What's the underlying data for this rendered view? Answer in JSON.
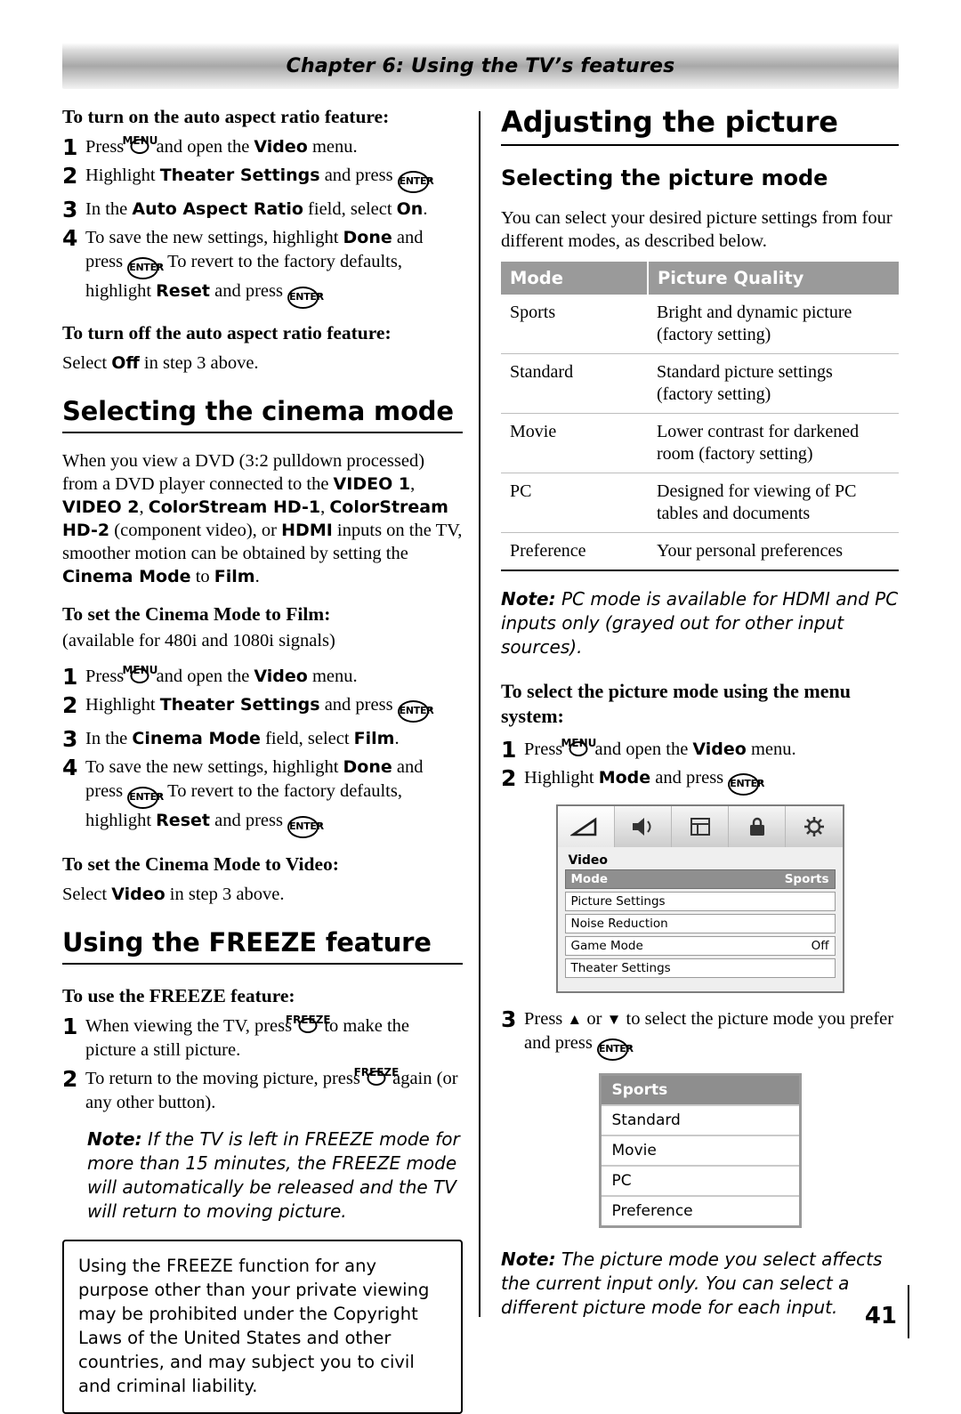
{
  "header": {
    "chapter": "Chapter 6: Using the TV’s features"
  },
  "page_number": "41",
  "left": {
    "auto_on_heading": "To turn on the auto aspect ratio feature:",
    "auto_on_steps": [
      {
        "num": "1",
        "parts": [
          "Press ",
          "MENU",
          " and open the ",
          "Video",
          " menu."
        ]
      },
      {
        "num": "2",
        "parts": [
          "Highlight ",
          "Theater Settings",
          " and press ",
          "ENTER",
          "."
        ]
      },
      {
        "num": "3",
        "parts": [
          "In the ",
          "Auto Aspect Ratio",
          " field, select ",
          "On",
          "."
        ]
      },
      {
        "num": "4",
        "parts": [
          "To save the new settings, highlight ",
          "Done",
          " and press ",
          "ENTER",
          ". To revert to the factory defaults, highlight ",
          "Reset",
          " and press ",
          "ENTER",
          "."
        ]
      }
    ],
    "auto_off_heading": "To turn off the auto aspect ratio feature:",
    "auto_off_text_pre": "Select ",
    "auto_off_text_bold": "Off",
    "auto_off_text_post": " in step 3 above.",
    "cinema_section_title": "Selecting the cinema mode",
    "cinema_intro": "When you view a DVD (3:2 pulldown processed) from a DVD player connected to the VIDEO 1, VIDEO 2, ColorStream HD-1, ColorStream HD-2 (component video), or HDMI inputs on the TV, smoother motion can be obtained by setting the Cinema Mode to Film.",
    "cinema_film_heading": "To set the Cinema Mode to Film:",
    "cinema_film_note": "(available for 480i and 1080i signals)",
    "cinema_steps": [
      {
        "num": "1",
        "parts": [
          "Press ",
          "MENU",
          " and open the ",
          "Video",
          " menu."
        ]
      },
      {
        "num": "2",
        "parts": [
          "Highlight ",
          "Theater Settings",
          " and press ",
          "ENTER",
          "."
        ]
      },
      {
        "num": "3",
        "parts": [
          "In the ",
          "Cinema Mode",
          " field, select ",
          "Film",
          "."
        ]
      },
      {
        "num": "4",
        "parts": [
          "To save the new settings, highlight ",
          "Done",
          " and press ",
          "ENTER",
          ". To revert to the factory defaults, highlight ",
          "Reset",
          " and press ",
          "ENTER",
          "."
        ]
      }
    ],
    "cinema_video_heading": "To set the Cinema Mode to Video:",
    "cinema_video_pre": "Select ",
    "cinema_video_bold": "Video",
    "cinema_video_post": " in step 3 above.",
    "freeze_section_title": "Using the FREEZE feature",
    "freeze_use_heading": "To use the FREEZE feature:",
    "freeze_steps": [
      {
        "num": "1",
        "parts": [
          "When viewing the TV, press ",
          "FREEZE",
          " to make the picture a still picture."
        ]
      },
      {
        "num": "2",
        "parts": [
          "To return to the moving picture, press ",
          "FREEZE",
          " again (or any other button)."
        ]
      }
    ],
    "freeze_note_label": "Note:",
    "freeze_note_text": " If the TV is left in FREEZE mode for more than 15 minutes, the FREEZE mode will automatically be released and the TV will return to moving picture.",
    "legal_text": "Using the FREEZE function for any purpose other than your private viewing may be prohibited under the Copyright Laws of the United States and other countries, and may subject you to civil and criminal liability."
  },
  "right": {
    "adjust_title": "Adjusting the picture",
    "picmode_title": "Selecting the picture mode",
    "picmode_intro": "You can select your desired picture settings from four different modes, as described below.",
    "table": {
      "headers": [
        "Mode",
        "Picture Quality"
      ],
      "rows": [
        [
          "Sports",
          "Bright and dynamic picture (factory setting)"
        ],
        [
          "Standard",
          "Standard picture settings (factory setting)"
        ],
        [
          "Movie",
          "Lower contrast for darkened room (factory setting)"
        ],
        [
          "PC",
          "Designed for viewing of PC tables and documents"
        ],
        [
          "Preference",
          "Your personal preferences"
        ]
      ]
    },
    "note_pc_label": "Note:",
    "note_pc_text": " PC mode is available for HDMI and PC inputs only (grayed out for other input sources).",
    "menu_heading": "To select the picture mode using the menu system:",
    "menu_steps": [
      {
        "num": "1",
        "parts": [
          "Press ",
          "MENU",
          " and open the ",
          "Video",
          " menu."
        ]
      },
      {
        "num": "2",
        "parts": [
          "Highlight ",
          "Mode",
          " and press ",
          "ENTER",
          "."
        ]
      }
    ],
    "osd": {
      "icons": [
        "screen-icon",
        "audio-icon",
        "preferences-icon",
        "lock-icon",
        "setup-icon"
      ],
      "selected_icon_index": 0,
      "panel_title": "Video",
      "rows": [
        {
          "label": "Mode",
          "value": "Sports",
          "highlight": true
        },
        {
          "label": "Picture Settings",
          "value": "",
          "highlight": false
        },
        {
          "label": "Noise Reduction",
          "value": "",
          "highlight": false
        },
        {
          "label": "Game Mode",
          "value": "Off",
          "highlight": false
        },
        {
          "label": "Theater Settings",
          "value": "",
          "highlight": false
        }
      ]
    },
    "step3": {
      "num": "3",
      "parts": [
        "Press ",
        "▲",
        " or ",
        "▼",
        " to select the picture mode you prefer and press ",
        "ENTER",
        "."
      ]
    },
    "modelist": [
      {
        "label": "Sports",
        "highlight": true
      },
      {
        "label": "Standard",
        "highlight": false
      },
      {
        "label": "Movie",
        "highlight": false
      },
      {
        "label": "PC",
        "highlight": false
      },
      {
        "label": "Preference",
        "highlight": false
      }
    ],
    "note_affect_label": "Note:",
    "note_affect_text": " The picture mode you select affects the current input only. You can select a different picture mode for each input."
  }
}
